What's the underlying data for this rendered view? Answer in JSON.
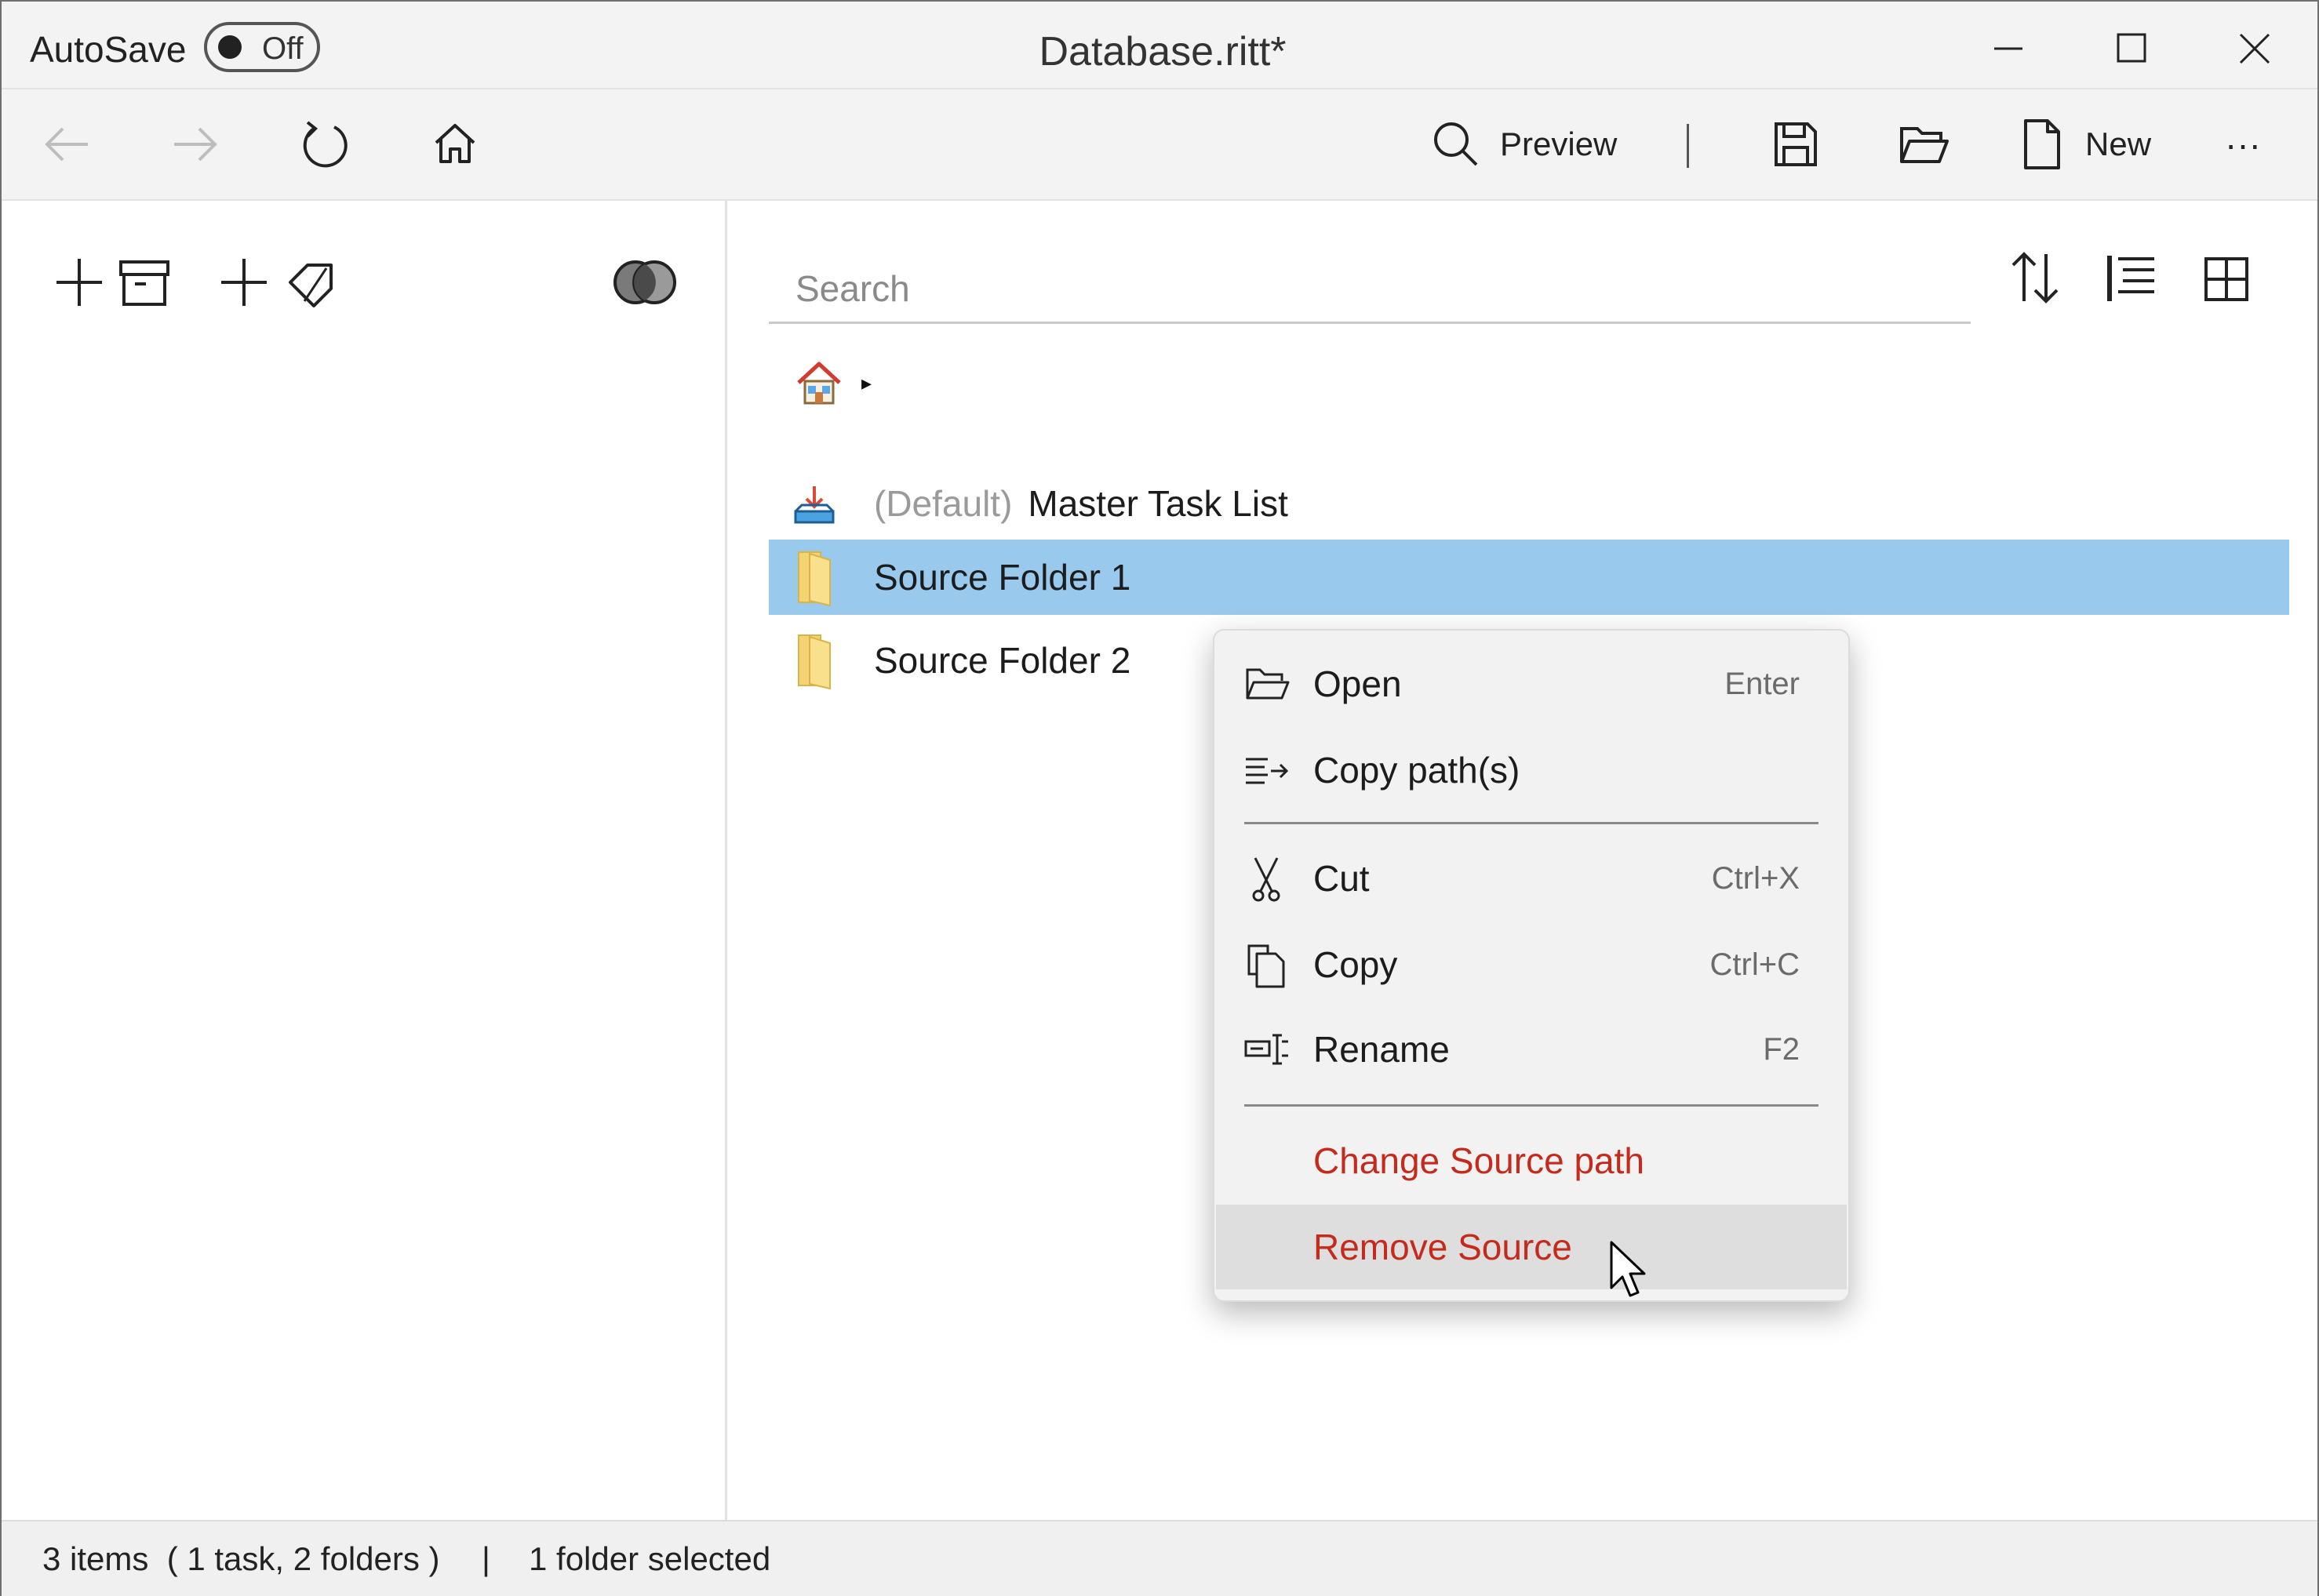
{
  "titlebar": {
    "autosave_label": "AutoSave",
    "autosave_state": "Off",
    "title": "Database.ritt*"
  },
  "toolbar": {
    "preview_label": "Preview",
    "new_label": "New",
    "more_label": "···"
  },
  "search": {
    "placeholder": "Search"
  },
  "breadcrumb": {
    "separator": "▸"
  },
  "items": [
    {
      "prefix": "(Default)",
      "label": "Master Task List",
      "icon": "task-list-icon",
      "selected": false
    },
    {
      "label": "Source Folder 1",
      "icon": "folder-icon",
      "selected": true
    },
    {
      "label": "Source Folder 2",
      "icon": "folder-icon",
      "selected": false
    }
  ],
  "context_menu": {
    "open": {
      "label": "Open",
      "shortcut": "Enter"
    },
    "copy_paths": {
      "label": "Copy path(s)"
    },
    "cut": {
      "label": "Cut",
      "shortcut": "Ctrl+X"
    },
    "copy": {
      "label": "Copy",
      "shortcut": "Ctrl+C"
    },
    "rename": {
      "label": "Rename",
      "shortcut": "F2"
    },
    "change_source": {
      "label": "Change Source path"
    },
    "remove_source": {
      "label": "Remove Source"
    }
  },
  "status": {
    "items_summary": "3 items  ( 1 task, 2 folders )",
    "separator": "|",
    "selection": "1 folder selected"
  },
  "colors": {
    "selection": "#99c9ec",
    "danger": "#c42b1c",
    "folder": "#f5d372"
  }
}
